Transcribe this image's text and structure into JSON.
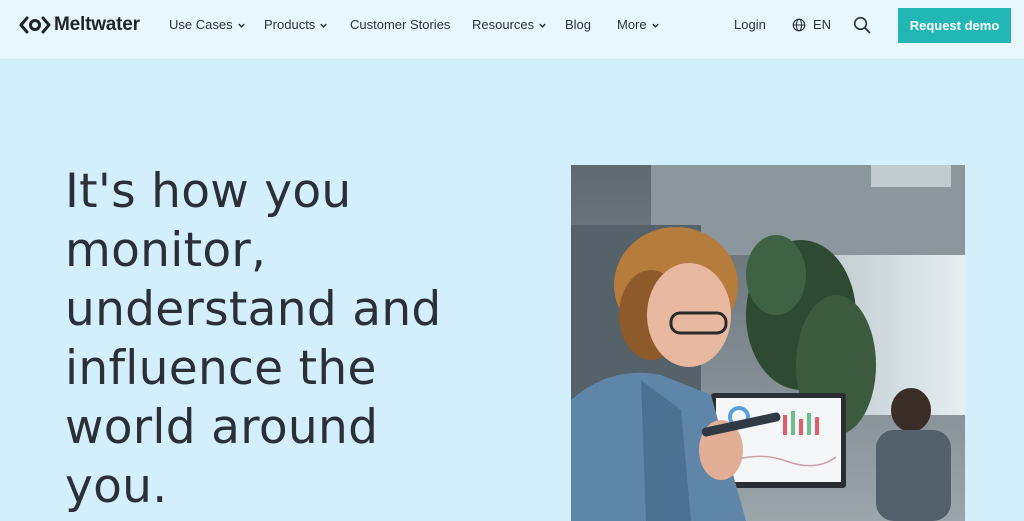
{
  "brand": {
    "name": "Meltwater"
  },
  "nav": {
    "use_cases": "Use Cases",
    "products": "Products",
    "customer_stories": "Customer Stories",
    "resources": "Resources",
    "blog": "Blog",
    "more": "More",
    "login": "Login",
    "language": "EN"
  },
  "cta": {
    "label": "Request demo"
  },
  "hero": {
    "headline_lines": [
      "It's how you",
      "monitor,",
      "understand and",
      "influence the",
      "world around",
      "you."
    ]
  },
  "colors": {
    "background": "#d4effc",
    "header_bg": "#e8f6fe",
    "accent": "#22b7b5",
    "text": "#2a2f38"
  }
}
